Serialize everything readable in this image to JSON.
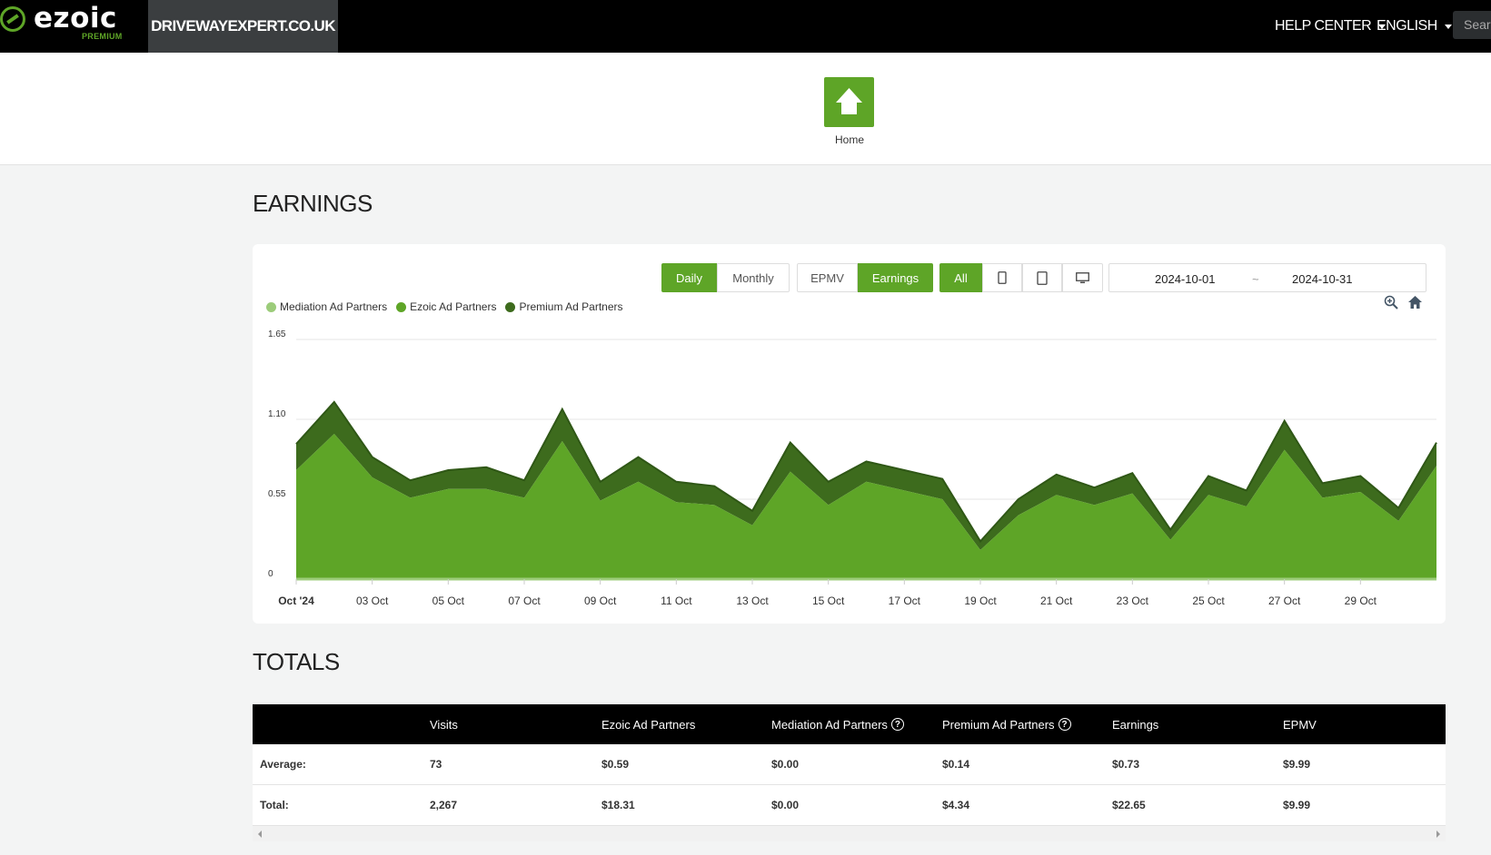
{
  "topbar": {
    "logo_text": "ezoic",
    "logo_sub": "PREMIUM",
    "site_name": "DRIVEWAYEXPERT.CO.UK",
    "help_center": "HELP CENTER",
    "language": "ENGLISH",
    "search_placeholder": "Searc",
    "colors": {
      "background": "#000000",
      "accent": "#5ea527",
      "site_tab": "#3b3e40"
    }
  },
  "home": {
    "label": "Home",
    "icon": "home-icon"
  },
  "earnings_section": {
    "title": "EARNINGS",
    "period_buttons": [
      {
        "label": "Daily",
        "active": true
      },
      {
        "label": "Monthly",
        "active": false
      }
    ],
    "metric_buttons": [
      {
        "label": "EPMV",
        "active": false
      },
      {
        "label": "Earnings",
        "active": true
      }
    ],
    "device_buttons": [
      {
        "label": "All",
        "icon": "",
        "active": true
      },
      {
        "label": "",
        "icon": "phone-icon",
        "active": false
      },
      {
        "label": "",
        "icon": "tablet-icon",
        "active": false
      },
      {
        "label": "",
        "icon": "desktop-icon",
        "active": false
      }
    ],
    "date_from": "2024-10-01",
    "date_separator": "~",
    "date_to": "2024-10-31",
    "tools": [
      "zoom-icon",
      "home-icon"
    ]
  },
  "chart_data": {
    "type": "area",
    "stacked": true,
    "title": "",
    "xlabel": "",
    "ylabel": "",
    "x": [
      "2024-10-01",
      "2024-10-02",
      "2024-10-03",
      "2024-10-04",
      "2024-10-05",
      "2024-10-06",
      "2024-10-07",
      "2024-10-08",
      "2024-10-09",
      "2024-10-10",
      "2024-10-11",
      "2024-10-12",
      "2024-10-13",
      "2024-10-14",
      "2024-10-15",
      "2024-10-16",
      "2024-10-17",
      "2024-10-18",
      "2024-10-19",
      "2024-10-20",
      "2024-10-21",
      "2024-10-22",
      "2024-10-23",
      "2024-10-24",
      "2024-10-25",
      "2024-10-26",
      "2024-10-27",
      "2024-10-28",
      "2024-10-29",
      "2024-10-30",
      "2024-10-31"
    ],
    "x_ticks": [
      "Oct '24",
      "03 Oct",
      "05 Oct",
      "07 Oct",
      "09 Oct",
      "11 Oct",
      "13 Oct",
      "15 Oct",
      "17 Oct",
      "19 Oct",
      "21 Oct",
      "23 Oct",
      "25 Oct",
      "27 Oct",
      "29 Oct"
    ],
    "y_ticks": [
      "0",
      "0.55",
      "1.10",
      "1.65"
    ],
    "ylim": [
      0,
      1.65
    ],
    "grid": true,
    "legend_position": "top-left",
    "series": [
      {
        "name": "Mediation Ad Partners",
        "color": "#9ccc7a",
        "values": [
          0,
          0,
          0,
          0,
          0,
          0,
          0,
          0,
          0,
          0,
          0,
          0,
          0,
          0,
          0,
          0,
          0,
          0,
          0,
          0,
          0,
          0,
          0,
          0,
          0,
          0,
          0,
          0,
          0,
          0,
          0
        ]
      },
      {
        "name": "Ezoic Ad Partners",
        "color": "#5ea527",
        "values": [
          0.75,
          1.0,
          0.7,
          0.56,
          0.62,
          0.62,
          0.56,
          0.95,
          0.54,
          0.67,
          0.53,
          0.51,
          0.37,
          0.74,
          0.51,
          0.67,
          0.61,
          0.55,
          0.2,
          0.44,
          0.58,
          0.51,
          0.59,
          0.27,
          0.58,
          0.5,
          0.89,
          0.56,
          0.6,
          0.4,
          0.78
        ]
      },
      {
        "name": "Premium Ad Partners",
        "color": "#3d6b1d",
        "values": [
          0.18,
          0.22,
          0.14,
          0.12,
          0.13,
          0.15,
          0.12,
          0.22,
          0.13,
          0.17,
          0.14,
          0.13,
          0.1,
          0.2,
          0.16,
          0.14,
          0.14,
          0.14,
          0.06,
          0.11,
          0.14,
          0.12,
          0.14,
          0.07,
          0.13,
          0.11,
          0.2,
          0.1,
          0.11,
          0.09,
          0.16
        ]
      }
    ]
  },
  "totals": {
    "title": "TOTALS",
    "columns": [
      "",
      "Visits",
      "Ezoic Ad Partners",
      "Mediation Ad Partners",
      "Premium Ad Partners",
      "Earnings",
      "EPMV"
    ],
    "help_columns": [
      3,
      4
    ],
    "rows": [
      [
        "Average:",
        "73",
        "$0.59",
        "$0.00",
        "$0.14",
        "$0.73",
        "$9.99"
      ],
      [
        "Total:",
        "2,267",
        "$18.31",
        "$0.00",
        "$4.34",
        "$22.65",
        "$9.99"
      ]
    ]
  }
}
